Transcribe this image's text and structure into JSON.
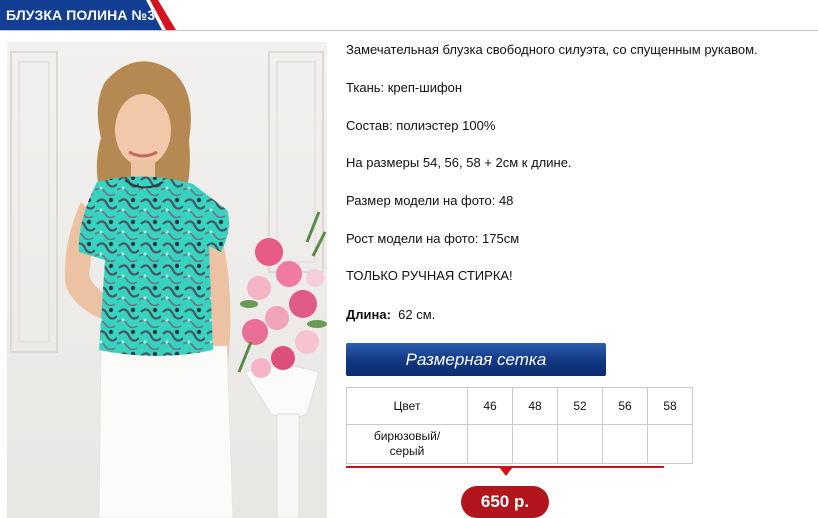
{
  "header": {
    "title": "БЛУЗКА ПОЛИНА №3"
  },
  "colors": {
    "title_blue": "#123e94",
    "title_red": "#d3141c",
    "banner_blue": "#123a85",
    "price_red": "#b3151c"
  },
  "description": {
    "line1": "Замечательная блузка свободного силуэта, со спущенным рукавом.",
    "fabric": "Ткань: креп-шифон",
    "composition": "Состав: полиэстер 100%",
    "sizes": "На размеры 54, 56, 58 + 2см к длине.",
    "model_size": "Размер модели на фото: 48",
    "model_height": "Рост модели на фото: 175см",
    "wash": "ТОЛЬКО РУЧНАЯ СТИРКА!",
    "length_label": "Длина:",
    "length_value": "62 см."
  },
  "size_grid": {
    "button_label": "Размерная сетка",
    "color_header": "Цвет",
    "sizes": [
      "46",
      "48",
      "52",
      "56",
      "58"
    ],
    "color_line1": "бирюзовый/",
    "color_line2": "серый"
  },
  "price": "650 р.",
  "photo": {
    "icon": "product-photo-model-in-turquoise-blouse"
  }
}
